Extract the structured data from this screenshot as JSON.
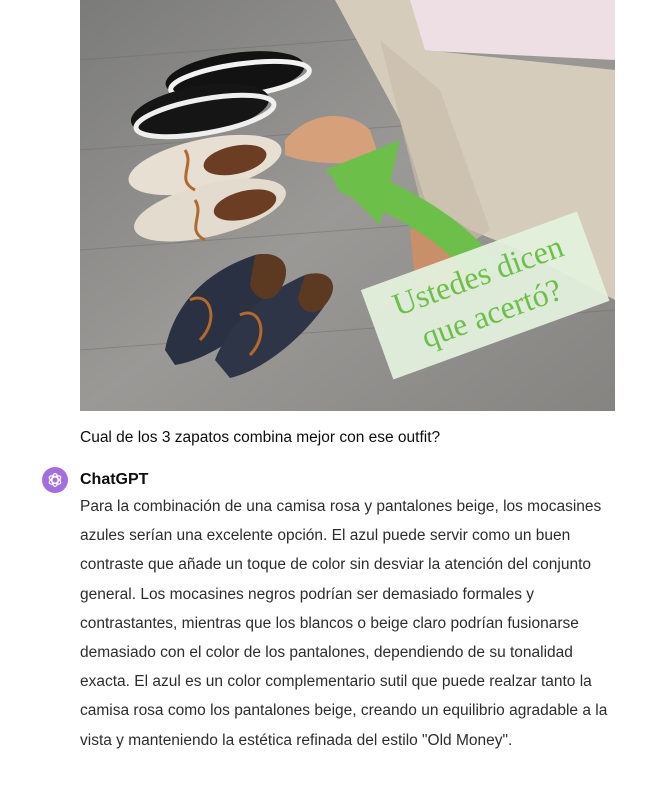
{
  "photo": {
    "overlay_text_line1": "Ustedes dicen",
    "overlay_text_line2": "que acertó?",
    "arrow_color": "#6cc04a",
    "overlay_text_color": "#6cc04a"
  },
  "user_message": "Cual de los 3 zapatos combina mejor con ese outfit?",
  "assistant": {
    "name": "ChatGPT",
    "avatar_icon": "openai-logo-icon",
    "avatar_color": "#a46ee0",
    "response": "Para la combinación de una camisa rosa y pantalones beige, los mocasines azules serían una excelente opción. El azul puede servir como un buen contraste que añade un toque de color sin desviar la atención del conjunto general. Los mocasines negros podrían ser demasiado formales y contrastantes, mientras que los blancos o beige claro podrían fusionarse demasiado con el color de los pantalones, dependiendo de su tonalidad exacta. El azul es un color complementario sutil que puede realzar tanto la camisa rosa como los pantalones beige, creando un equilibrio agradable a la vista y manteniendo la estética refinada del estilo \"Old Money\"."
  }
}
